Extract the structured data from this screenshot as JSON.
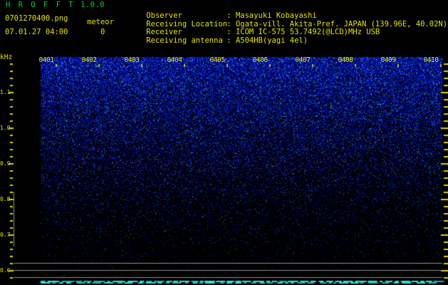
{
  "title": {
    "app": "H R O F F T",
    "version": "1.0.0"
  },
  "header": {
    "filename": "0701270400.png",
    "datetime": "07.01.27 04:00",
    "meteor_label": "meteor",
    "meteor_count": "0",
    "colon": ":",
    "info": [
      {
        "label": "Observer",
        "value": "Masayuki Kobayashi"
      },
      {
        "label": "Receiving Location",
        "value": "Ogata-vill. Akita-Pref. JAPAN (139.96E, 40.02N)"
      },
      {
        "label": "Receiver",
        "value": "ICOM IC-575 53.7492(@LCD)MHz USB"
      },
      {
        "label": "Receiving antenna",
        "value": "A504HB(yagi 4el)"
      }
    ]
  },
  "axes": {
    "unit": "kHz",
    "y_ticks": [
      "1.1",
      "1.0",
      "0.9",
      "0.8",
      "0.7",
      "0.6"
    ],
    "x_labels": [
      "0401",
      "0402",
      "0403",
      "0404",
      "0405",
      "0406",
      "0407",
      "0408",
      "0409",
      "0410"
    ]
  },
  "colors": {
    "text_yellow": "#e3e300",
    "title_green": "#00cf38",
    "tick_yellow": "#d6d600",
    "minute_tick": "#b9b955",
    "gray_line": "#8f8f8f",
    "cyan_bright": "#2edddd",
    "cyan_dim": "#17b4b4",
    "noise_palette": [
      "#000a50",
      "#0a2896",
      "#2050dc",
      "#52a0ff"
    ]
  },
  "chart_data": {
    "type": "heatmap",
    "title": "H R O F F T 1.0.0",
    "xlabel": "",
    "ylabel": "kHz",
    "x_tick_labels": [
      "0401",
      "0402",
      "0403",
      "0404",
      "0405",
      "0406",
      "0407",
      "0408",
      "0409",
      "0410"
    ],
    "x_range_minutes": [
      "0400",
      "0410"
    ],
    "y_tick_labels": [
      1.1,
      1.0,
      0.9,
      0.8,
      0.7,
      0.6
    ],
    "ylim": [
      0.58,
      1.19
    ],
    "meteor_count": 0,
    "reference_line_levels_khz": [
      0.62,
      0.6,
      0.58
    ],
    "content_description": "Broadband blue background noise densest near 1.1-1.2 kHz fading to black below ~0.8 kHz; no meteor echo traces; irregular cyan signal-level dashes along the bottom edge."
  }
}
